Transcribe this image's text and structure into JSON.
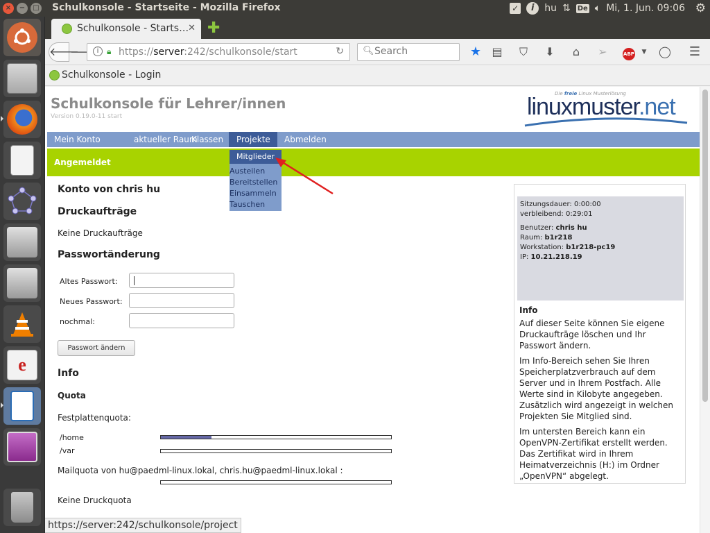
{
  "window": {
    "title": "Schulkonsole - Startseite - Mozilla Firefox"
  },
  "panel": {
    "keyboard_label": "hu",
    "keyboard_layout": "De",
    "clock": "Mi,  1. Jun. 09:06"
  },
  "launcher": {
    "items": [
      "ubuntu-dash",
      "files-cabinet",
      "firefox",
      "document-viewer",
      "graph-app",
      "drive-1",
      "drive-2",
      "vlc",
      "pdf-reader",
      "writer-app",
      "screen-app",
      "trash"
    ]
  },
  "browser": {
    "tab_title": "Schulkonsole - Starts…",
    "url_prefix": "https://",
    "url_host": "server",
    "url_rest": ":242/schulkonsole/start",
    "search_placeholder": "Search",
    "bookmark": "Schulkonsole - Login",
    "status_url": "https://server:242/schulkonsole/project"
  },
  "site": {
    "title": "Schulkonsole für Lehrer/innen",
    "version": "Version 0.19.0-11 start",
    "logo_tagline_prefix": "Die",
    "logo_tagline_bold": "freie",
    "logo_tagline_suffix": "Linux Musterlösung",
    "logo_word": "linuxmuster",
    "logo_dot": ".",
    "logo_net": "net"
  },
  "menu": {
    "items": [
      "Mein Konto",
      "aktueller Raum",
      "Klassen",
      "Projekte",
      "Abmelden"
    ],
    "active": "Projekte"
  },
  "dropdown": {
    "active": "Mitglieder",
    "items": [
      "Austeilen",
      "Bereitstellen",
      "Einsammeln",
      "Tauschen"
    ]
  },
  "status_bar": "Angemeldet",
  "main": {
    "heading": "Konto von chris hu",
    "print_heading": "Druckaufträge",
    "print_text": "Keine Druckaufträge",
    "pw_heading": "Passwortänderung",
    "pw_old": "Altes Passwort:",
    "pw_new": "Neues Passwort:",
    "pw_repeat": "nochmal:",
    "pw_button": "Passwort ändern",
    "info_heading": "Info",
    "quota_heading": "Quota",
    "disk_quota": "Festplattenquota:",
    "quotas": [
      {
        "label": "/home",
        "fill": 0.22
      },
      {
        "label": "/var",
        "fill": 0
      }
    ],
    "mail_quota": "Mailquota von hu@paedml-linux.lokal, chris.hu@paedml-linux.lokal :",
    "mail_fill": 0,
    "print_quota": "Keine Druckquota"
  },
  "sidebar": {
    "session_label": "Sitzungsdauer:",
    "session_value": "0:00:00",
    "remaining_label": "verbleibend:",
    "remaining_value": "0:29:01",
    "user_label": "Benutzer:",
    "user_value": "chris hu",
    "room_label": "Raum:",
    "room_value": "b1r218",
    "ws_label": "Workstation:",
    "ws_value": "b1r218-pc19",
    "ip_label": "IP:",
    "ip_value": "10.21.218.19",
    "info_heading": "Info",
    "p1": "Auf dieser Seite können Sie eigene Druckaufträge löschen und Ihr Passwort ändern.",
    "p2": "Im Info-Bereich sehen Sie Ihren Speicherplatzverbrauch auf dem Server und in Ihrem Postfach. Alle Werte sind in Kilobyte angegeben. Zusätzlich wird angezeigt in welchen Projekten Sie Mitglied sind.",
    "p3": "Im untersten Bereich kann ein OpenVPN-Zertifikat erstellt werden. Das Zertifikat wird in Ihrem Heimatverzeichnis (H:) im Ordner „OpenVPN“ abgelegt."
  },
  "colors": {
    "menu_bg": "#7f9ccb",
    "menu_active": "#3d5c98",
    "green_bar": "#a8d300",
    "annotation_arrow": "#e02020"
  }
}
